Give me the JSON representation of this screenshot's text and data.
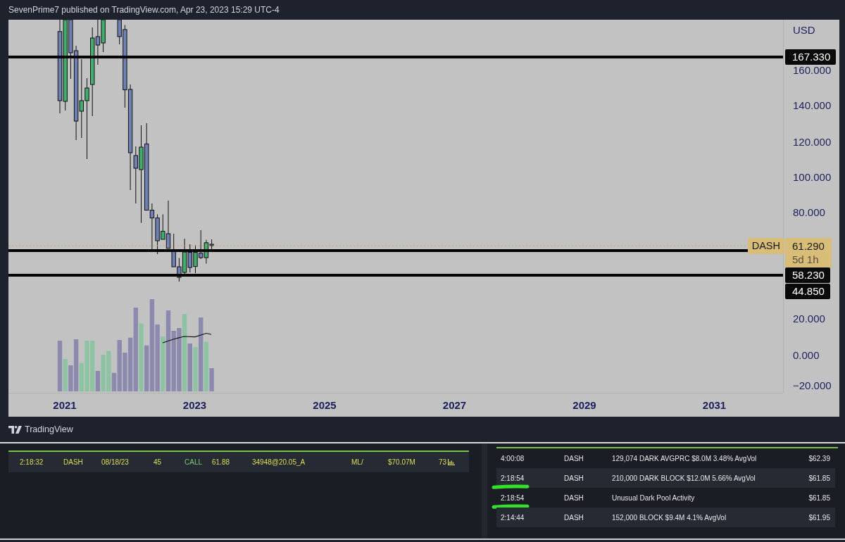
{
  "header": {
    "text": "SevenPrime7 published on TradingView.com, Apr 23, 2023 15:29 UTC-4"
  },
  "chart": {
    "currency": "USD",
    "price_ticks": [
      "160.000",
      "140.000",
      "120.000",
      "100.000",
      "80.000",
      "20.000",
      "0.000",
      "−20.000"
    ],
    "level_labels": [
      "167.330",
      "58.230",
      "44.850"
    ],
    "symbol_tag": {
      "symbol": "DASH",
      "price": "61.290",
      "countdown": "5d 1h"
    },
    "time_ticks": [
      "2021",
      "2023",
      "2025",
      "2027",
      "2029",
      "2031"
    ]
  },
  "footer": {
    "brand": "TradingView"
  },
  "options_flow": {
    "rows": [
      {
        "time": "2:18:32",
        "ticker": "DASH",
        "expiry": "08/18/23",
        "column_4": "45",
        "type": "CALL",
        "column_6": "61.88",
        "column_7": "34948@20.05_A",
        "column_8": "ML/",
        "premium": "$70.07M",
        "column_10": "73"
      }
    ]
  },
  "dark_pool": {
    "rows": [
      {
        "time": "4:00:08",
        "ticker": "DASH",
        "description": "129,074 DARK AVGPRC $8.0M 3.48% AvgVol",
        "price": "$62.39",
        "highlighted": false
      },
      {
        "time": "2:18:54",
        "ticker": "DASH",
        "description": "210,000 DARK BLOCK $12.0M 5.66% AvgVol",
        "price": "$61.85",
        "highlighted": true
      },
      {
        "time": "2:18:54",
        "ticker": "DASH",
        "description": "Unusual Dark Pool Activity",
        "price": "$61.85",
        "highlighted": true
      },
      {
        "time": "2:14:44",
        "ticker": "DASH",
        "description": "152,000 BLOCK $9.4M 4.1% AvgVol",
        "price": "$61.95",
        "highlighted": false
      }
    ]
  }
}
